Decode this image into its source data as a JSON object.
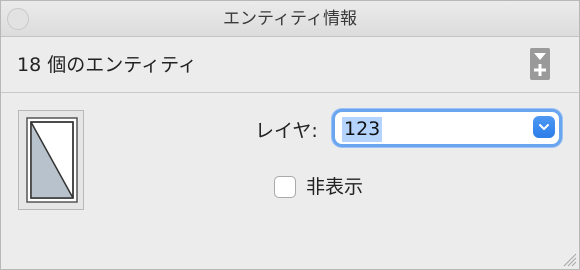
{
  "window": {
    "title": "エンティティ情報"
  },
  "header": {
    "entity_count_label": "18 個のエンティティ",
    "expand_icon": "expand-toggle-icon"
  },
  "thumbnail": {
    "icon": "door-component-icon"
  },
  "layer": {
    "label": "レイヤ:",
    "selected_value": "123",
    "accent_color": "#2b7de9"
  },
  "visibility": {
    "hidden_label": "非表示",
    "hidden_checked": false
  }
}
